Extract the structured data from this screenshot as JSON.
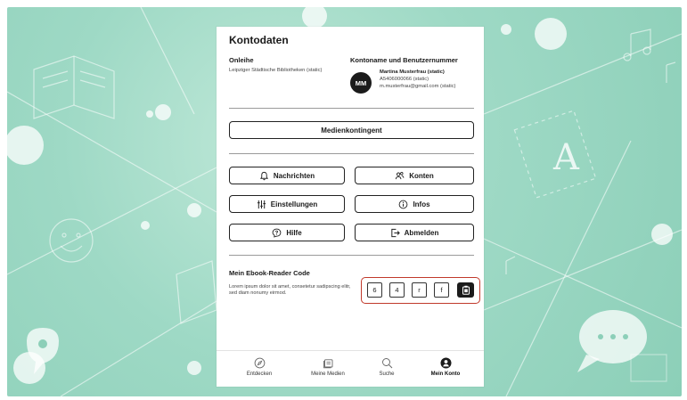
{
  "page": {
    "title": "Kontodaten"
  },
  "onleihe": {
    "label": "Onleihe",
    "library": "Leipziger Städtische Bibliotheken (static)"
  },
  "account": {
    "label": "Kontoname und Benutzernummer",
    "avatar_initials": "MM",
    "name": "Martina Musterfrau (static)",
    "number": "A5406000066 (static)",
    "email": "m.musterfrau@gmail.com (static)"
  },
  "buttons": {
    "medienkontingent": "Medienkontingent",
    "nachrichten": "Nachrichten",
    "konten": "Konten",
    "einstellungen": "Einstellungen",
    "infos": "Infos",
    "hilfe": "Hilfe",
    "abmelden": "Abmelden"
  },
  "ebook": {
    "label": "Mein Ebook-Reader Code",
    "description": "Lorem ipsum dolor sit amet, consetetur sadipscing elitr, sed diam nonumy eirmod.",
    "code": [
      "6",
      "4",
      "r",
      "f"
    ],
    "highlight_color": "#c0392b"
  },
  "tabbar": {
    "items": [
      {
        "label": "Entdecken",
        "icon": "compass-icon"
      },
      {
        "label": "Meine Medien",
        "icon": "media-icon"
      },
      {
        "label": "Suche",
        "icon": "search-icon"
      },
      {
        "label": "Mein Konto",
        "icon": "user-icon"
      }
    ],
    "active": "Mein Konto"
  },
  "colors": {
    "background_mint": "#9ed9c5",
    "accent_dark": "#1b1b1b"
  }
}
